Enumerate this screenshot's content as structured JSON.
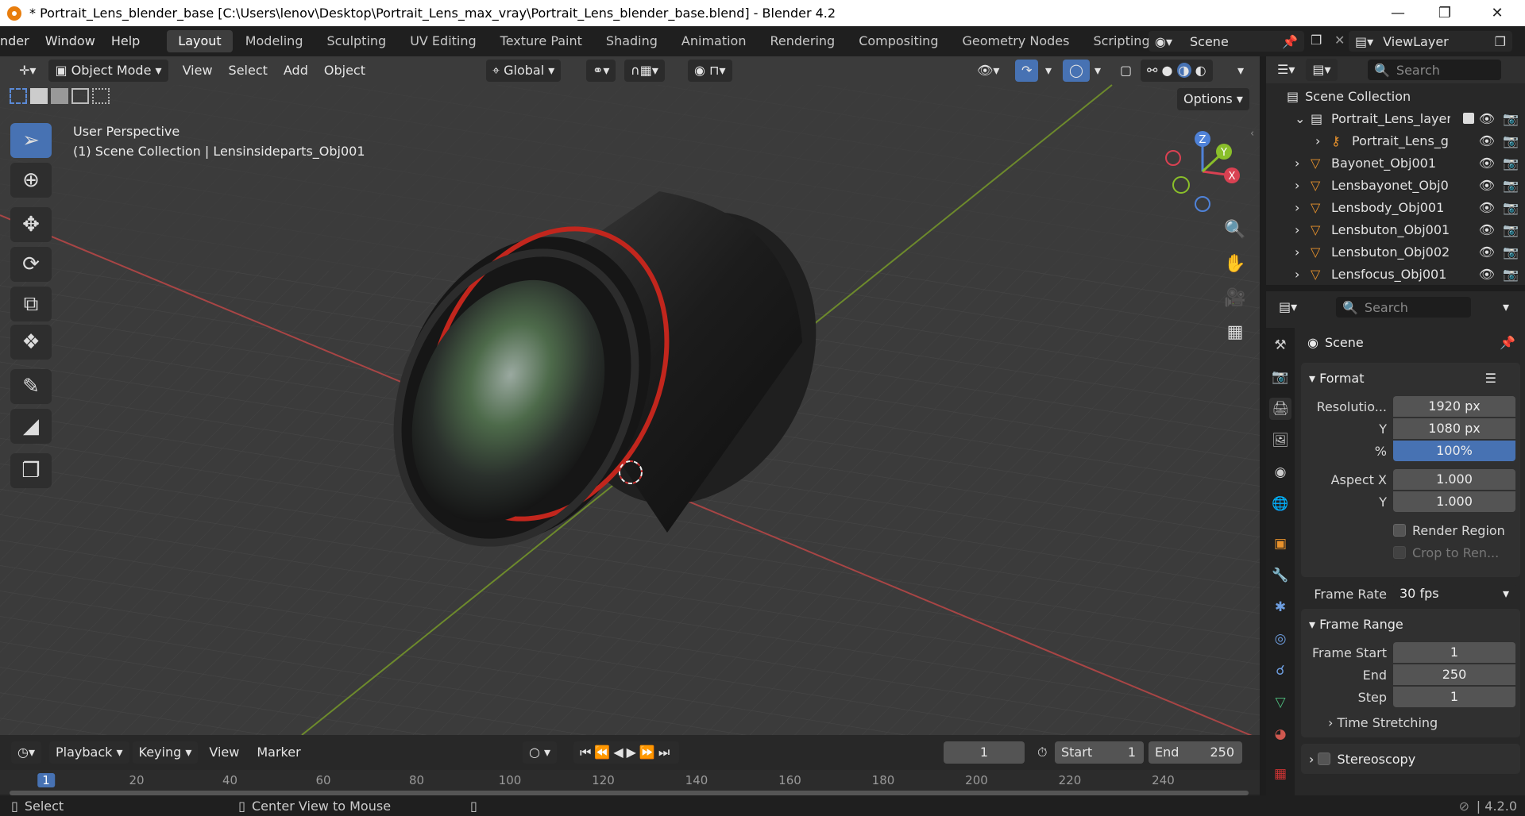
{
  "titlebar": {
    "title": "* Portrait_Lens_blender_base [C:\\Users\\lenov\\Desktop\\Portrait_Lens_max_vray\\Portrait_Lens_blender_base.blend] - Blender 4.2"
  },
  "menu": [
    "nder",
    "Window",
    "Help"
  ],
  "workspaces": [
    "Layout",
    "Modeling",
    "Sculpting",
    "UV Editing",
    "Texture Paint",
    "Shading",
    "Animation",
    "Rendering",
    "Compositing",
    "Geometry Nodes",
    "Scripting"
  ],
  "scene_name": "Scene",
  "view_layer": "ViewLayer",
  "viewport": {
    "mode": "Object Mode",
    "menus": [
      "View",
      "Select",
      "Add",
      "Object"
    ],
    "orientation": "Global",
    "options_label": "Options",
    "overlay_line1": "User Perspective",
    "overlay_line2": "(1) Scene Collection | Lensinsideparts_Obj001",
    "gizmo": {
      "x": "X",
      "y": "Y",
      "z": "Z"
    }
  },
  "outliner": {
    "search_placeholder": "Search",
    "root": "Scene Collection",
    "items": [
      {
        "name": "Portrait_Lens_layer",
        "level": 1
      },
      {
        "name": "Portrait_Lens_g",
        "level": 2
      },
      {
        "name": "Bayonet_Obj001",
        "level": 1
      },
      {
        "name": "Lensbayonet_Obj0",
        "level": 1
      },
      {
        "name": "Lensbody_Obj001",
        "level": 1
      },
      {
        "name": "Lensbuton_Obj001",
        "level": 1
      },
      {
        "name": "Lensbuton_Obj002",
        "level": 1
      },
      {
        "name": "Lensfocus_Obj001",
        "level": 1
      }
    ]
  },
  "properties": {
    "search_placeholder": "Search",
    "context": "Scene",
    "format": {
      "title": "Format",
      "resolution_label": "Resolutio...",
      "res_x": "1920 px",
      "y_label": "Y",
      "res_y": "1080 px",
      "pct_label": "%",
      "pct": "100%",
      "aspect_label": "Aspect X",
      "aspect_x": "1.000",
      "aspect_y": "1.000",
      "render_region": "Render Region",
      "crop": "Crop to Ren...",
      "frame_rate_label": "Frame Rate",
      "frame_rate": "30 fps"
    },
    "frame_range": {
      "title": "Frame Range",
      "start_label": "Frame Start",
      "start": "1",
      "end_label": "End",
      "end": "250",
      "step_label": "Step",
      "step": "1"
    },
    "time_stretching": "Time Stretching",
    "stereoscopy": "Stereoscopy"
  },
  "timeline": {
    "menus": [
      "Playback",
      "Keying",
      "View",
      "Marker"
    ],
    "current_frame": "1",
    "start_label": "Start",
    "start": "1",
    "end_label": "End",
    "end": "250",
    "ticks": [
      "1",
      "20",
      "40",
      "60",
      "80",
      "100",
      "120",
      "140",
      "160",
      "180",
      "200",
      "220",
      "240"
    ]
  },
  "statusbar": {
    "select": "Select",
    "center": "Center View to Mouse",
    "version": "4.2.0"
  }
}
